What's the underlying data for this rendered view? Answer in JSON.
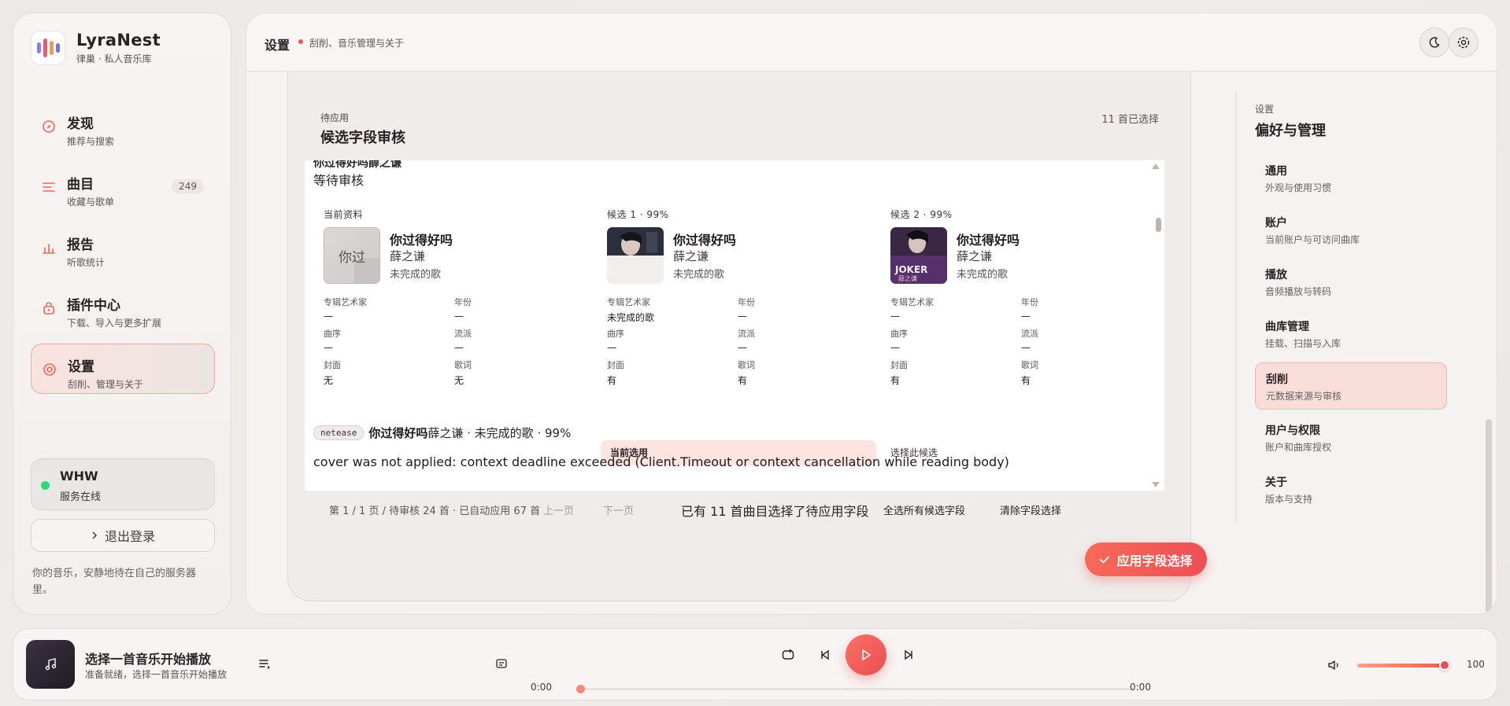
{
  "brand": {
    "name": "LyraNest",
    "sub": "律巢 · 私人音乐库"
  },
  "nav": {
    "items": [
      {
        "title": "发现",
        "sub": "推荐与搜索",
        "icon": "compass-icon"
      },
      {
        "title": "曲目",
        "sub": "收藏与歌单",
        "icon": "list-icon",
        "count": "249"
      },
      {
        "title": "报告",
        "sub": "听歌统计",
        "icon": "bar-chart-icon"
      },
      {
        "title": "插件中心",
        "sub": "下载、导入与更多扩展",
        "icon": "plugin-icon"
      },
      {
        "title": "设置",
        "sub": "刮削、管理与关于",
        "icon": "settings-icon",
        "active": true
      }
    ]
  },
  "server": {
    "name": "WHW",
    "status": "服务在线",
    "status_color": "#3fd07a"
  },
  "logout": {
    "label": "退出登录"
  },
  "tagline": "你的音乐，安静地待在自己的服务器里。",
  "header": {
    "title": "设置",
    "sub": "刮削、音乐管理与关于"
  },
  "review": {
    "eyebrow": "待应用",
    "title": "候选字段审核",
    "selected_count": "11 首已选择",
    "cut_title": "你过得好吗薛之谦",
    "pending": "等待审核",
    "columns": [
      {
        "head": "当前资料",
        "cover_text": "你过",
        "title": "你过得好吗",
        "artist": "薛之谦",
        "album": "未完成的歌",
        "fields": [
          {
            "label": "专辑艺术家",
            "value": "—"
          },
          {
            "label": "年份",
            "value": "—"
          },
          {
            "label": "曲序",
            "value": "—"
          },
          {
            "label": "流派",
            "value": "—"
          },
          {
            "label": "封面",
            "value": "无"
          },
          {
            "label": "歌词",
            "value": "无"
          }
        ]
      },
      {
        "head": "候选 1 · 99%",
        "title": "你过得好吗",
        "artist": "薛之谦",
        "album": "未完成的歌",
        "fields": [
          {
            "label": "专辑艺术家",
            "value": "未完成的歌"
          },
          {
            "label": "年份",
            "value": "—"
          },
          {
            "label": "曲序",
            "value": "—"
          },
          {
            "label": "流派",
            "value": "—"
          },
          {
            "label": "封面",
            "value": "有"
          },
          {
            "label": "歌词",
            "value": "有"
          }
        ],
        "choice": "当前选用"
      },
      {
        "head": "候选 2 · 99%",
        "title": "你过得好吗",
        "artist": "薛之谦",
        "album": "未完成的歌",
        "fields": [
          {
            "label": "专辑艺术家",
            "value": "—"
          },
          {
            "label": "年份",
            "value": "—"
          },
          {
            "label": "曲序",
            "value": "—"
          },
          {
            "label": "流派",
            "value": "—"
          },
          {
            "label": "封面",
            "value": "有"
          },
          {
            "label": "歌词",
            "value": "有"
          }
        ],
        "choice": "选择此候选"
      }
    ],
    "source_badge": "netease",
    "source_song": "你过得好吗",
    "source_rest": "薛之谦 · 未完成的歌 · 99%",
    "error": "cover was not applied: context deadline exceeded (Client.Timeout or context cancellation while reading body)",
    "pager": {
      "info": "第 1 / 1 页 / 待审核 24 首 · 已自动应用 67 首",
      "prev": "上一页",
      "next": "下一页",
      "selected_info": "已有 11 首曲目选择了待应用字段",
      "select_all": "全选所有候选字段",
      "clear": "清除字段选择"
    },
    "apply": "应用字段选择"
  },
  "settings_nav": {
    "eyebrow": "设置",
    "title": "偏好与管理",
    "items": [
      {
        "title": "通用",
        "sub": "外观与使用习惯"
      },
      {
        "title": "账户",
        "sub": "当前账户与可访问曲库"
      },
      {
        "title": "播放",
        "sub": "音频播放与转码"
      },
      {
        "title": "曲库管理",
        "sub": "挂载、扫描与入库"
      },
      {
        "title": "刮削",
        "sub": "元数据来源与审核",
        "active": true
      },
      {
        "title": "用户与权限",
        "sub": "账户和曲库授权"
      },
      {
        "title": "关于",
        "sub": "版本与支持"
      }
    ]
  },
  "player": {
    "title": "选择一首音乐开始播放",
    "sub": "准备就绪，选择一首音乐开始播放",
    "time_current": "0:00",
    "time_total": "0:00",
    "progress": 0,
    "volume": "100",
    "accent": "#ee4e55"
  }
}
